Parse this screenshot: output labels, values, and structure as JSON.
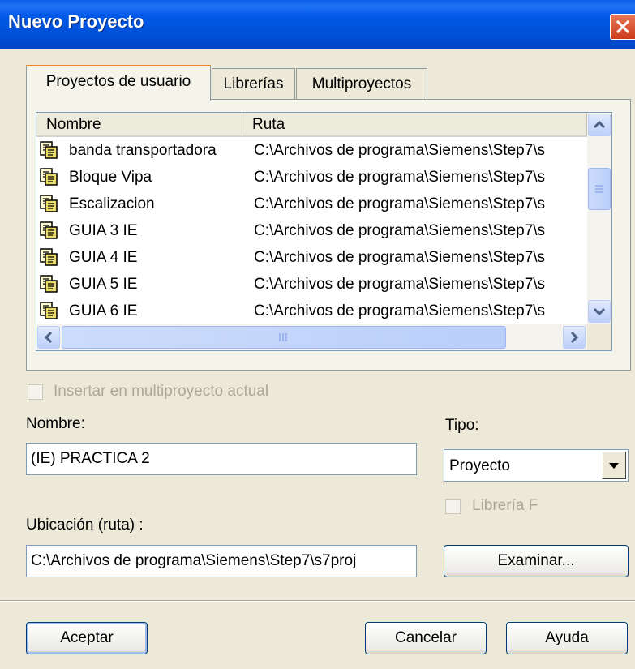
{
  "window": {
    "title": "Nuevo Proyecto"
  },
  "tabs": [
    {
      "label": "Proyectos de usuario",
      "active": true
    },
    {
      "label": "Librerías",
      "active": false
    },
    {
      "label": "Multiproyectos",
      "active": false
    }
  ],
  "list": {
    "columns": [
      "Nombre",
      "Ruta"
    ],
    "rows": [
      {
        "name": "banda transportadora",
        "path": "C:\\Archivos de programa\\Siemens\\Step7\\s"
      },
      {
        "name": "Bloque Vipa",
        "path": "C:\\Archivos de programa\\Siemens\\Step7\\s"
      },
      {
        "name": "Escalizacion",
        "path": "C:\\Archivos de programa\\Siemens\\Step7\\s"
      },
      {
        "name": "GUIA 3 IE",
        "path": "C:\\Archivos de programa\\Siemens\\Step7\\s"
      },
      {
        "name": "GUIA 4 IE",
        "path": "C:\\Archivos de programa\\Siemens\\Step7\\s"
      },
      {
        "name": "GUIA 5 IE",
        "path": "C:\\Archivos de programa\\Siemens\\Step7\\s"
      },
      {
        "name": "GUIA 6 IE",
        "path": "C:\\Archivos de programa\\Siemens\\Step7\\s"
      }
    ],
    "row_icon": "project-icon"
  },
  "form": {
    "insert_multiproject_label": "Insertar en multiproyecto actual",
    "insert_multiproject_checked": false,
    "name_label": "Nombre:",
    "name_value": "(IE) PRACTICA 2",
    "type_label": "Tipo:",
    "type_value": "Proyecto",
    "lib_f_label": "Librería F",
    "lib_f_checked": false,
    "location_label": "Ubicación (ruta) :",
    "location_value": "C:\\Archivos de programa\\Siemens\\Step7\\s7proj"
  },
  "buttons": {
    "browse": "Examinar...",
    "accept": "Aceptar",
    "cancel": "Cancelar",
    "help": "Ayuda"
  },
  "colors": {
    "titlebar": "#0050d8",
    "dialog_bg": "#ece9d8",
    "close_button": "#d9522e",
    "tab_highlight": "#e68b2c"
  }
}
